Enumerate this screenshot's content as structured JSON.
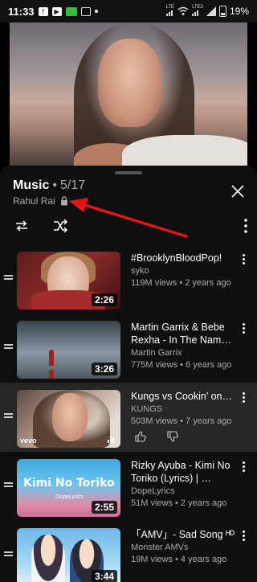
{
  "status_bar": {
    "time": "11:33",
    "left_icons": [
      "facebook-icon",
      "youtube-icon",
      "whatsapp-icon",
      "messages-icon",
      "dot-icon"
    ],
    "network_small_1": "LTE",
    "network_small_2": "LTE2",
    "battery_percent": "19%"
  },
  "playlist": {
    "title": "Music",
    "separator": " • ",
    "position": "5/17",
    "owner": "Rahul Rai",
    "privacy_icon": "lock-icon"
  },
  "controls": {
    "loop_icon": "repeat-icon",
    "shuffle_icon": "shuffle-icon",
    "more_icon": "more-vertical-icon"
  },
  "annotation": {
    "arrow_color": "#e0161b"
  },
  "videos": [
    {
      "title": "#BrooklynBloodPop!",
      "channel": "syko",
      "meta": "119M views • 2 years ago",
      "duration": "2:26",
      "active": false
    },
    {
      "title": "Martin Garrix & Bebe Rexha - In The Nam…",
      "channel": "Martin Garrix",
      "meta": "775M views • 6 years ago",
      "duration": "3:26",
      "active": false
    },
    {
      "title": "Kungs vs Cookin’ on…",
      "channel": "KUNGS",
      "meta": "503M views • 7 years ago",
      "duration": "",
      "badge": "vevo",
      "active": true
    },
    {
      "title": "Rizky Ayuba - Kimi No Toriko (Lyrics) | …",
      "channel": "DopeLyrics",
      "meta": "51M views • 2 years ago",
      "duration": "2:55",
      "thumb_text": "Kimi No Toriko",
      "thumb_sub": "DopeLyrics",
      "active": false
    },
    {
      "title": "「AMV」- Sad Song ᴴᴰ",
      "channel": "Monster AMVs",
      "meta": "19M views • 4 years ago",
      "duration": "3:44",
      "active": false
    }
  ]
}
